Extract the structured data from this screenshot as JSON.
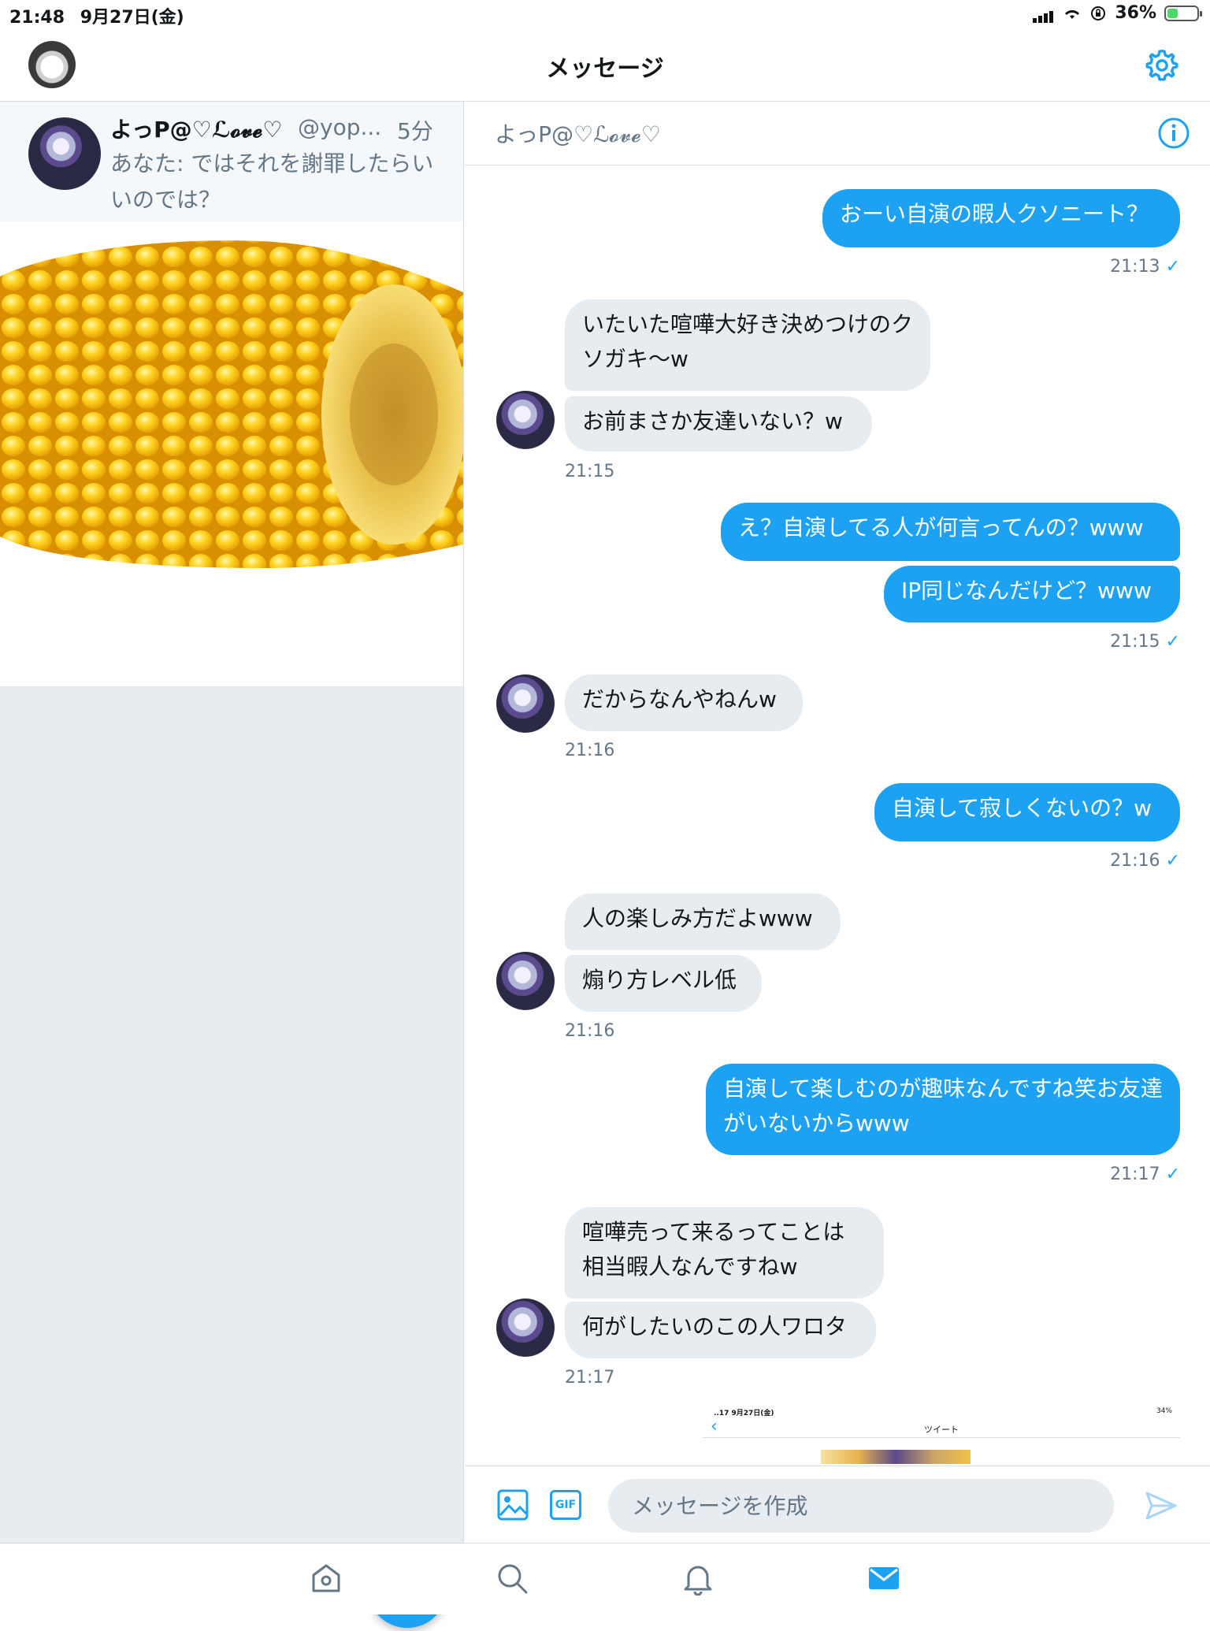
{
  "status": {
    "time": "21:48",
    "date": "9月27日(金)",
    "battery": "36%",
    "battery_level": 0.36
  },
  "nav": {
    "title": "メッセージ"
  },
  "conversation": {
    "name": "よっP@♡ℒ𝓸𝓿𝓮♡",
    "handle": "@yop...",
    "time": "5分",
    "preview": "あなた: ではそれを謝罪したらいいのでは？"
  },
  "chat": {
    "title": "よっP@♡ℒ𝓸𝓿𝓮♡",
    "messages": [
      {
        "id": "m1",
        "dir": "out",
        "text": "おーい自演の暇人クソニート？"
      },
      {
        "id": "m2",
        "dir": "in",
        "text": "いたいた喧嘩大好き決めつけのクソガキ〜w"
      },
      {
        "id": "m3",
        "dir": "in",
        "text": "お前まさか友達いない？w"
      },
      {
        "id": "m4",
        "dir": "out",
        "text": "え？自演してる人が何言ってんの？www"
      },
      {
        "id": "m5",
        "dir": "out",
        "text": "IP同じなんだけど？www"
      },
      {
        "id": "m6",
        "dir": "in",
        "text": "だからなんやねんw"
      },
      {
        "id": "m7",
        "dir": "out",
        "text": "自演して寂しくないの？w"
      },
      {
        "id": "m8",
        "dir": "in",
        "text": "人の楽しみ方だよwww"
      },
      {
        "id": "m9",
        "dir": "in",
        "text": "煽り方レベル低"
      },
      {
        "id": "m10",
        "dir": "out",
        "text": "自演して楽しむのが趣味なんですね笑お友達がいないからwww"
      },
      {
        "id": "m11",
        "dir": "in",
        "text": "喧嘩売って来るってことは相当暇人なんですねw"
      },
      {
        "id": "m12",
        "dir": "in",
        "text": "何がしたいのこの人ワロタ"
      }
    ],
    "timestamps": [
      {
        "id": "t1",
        "text": "21:13",
        "check": "✓"
      },
      {
        "id": "t2",
        "text": "21:15",
        "check": ""
      },
      {
        "id": "t3",
        "text": "21:15",
        "check": "✓"
      },
      {
        "id": "t4",
        "text": "21:16",
        "check": ""
      },
      {
        "id": "t5",
        "text": "21:16",
        "check": "✓"
      },
      {
        "id": "t6",
        "text": "21:16",
        "check": ""
      },
      {
        "id": "t7",
        "text": "21:17",
        "check": "✓"
      },
      {
        "id": "t8",
        "text": "21:17",
        "check": ""
      }
    ],
    "embed": {
      "status_time": "..17",
      "status_date": "9月27日(金)",
      "status_battery": "34%",
      "back": "‹",
      "title": "ツイート"
    }
  },
  "compose": {
    "placeholder": "メッセージを作成",
    "gif_label": "GIF"
  },
  "tabs": [
    {
      "id": "home",
      "icon": "home-icon",
      "active": false
    },
    {
      "id": "search",
      "icon": "search-icon",
      "active": false
    },
    {
      "id": "notifications",
      "icon": "bell-icon",
      "active": false
    },
    {
      "id": "messages",
      "icon": "envelope-icon",
      "active": true
    }
  ],
  "colors": {
    "accent": "#1da1f2",
    "panel_bg": "#e6ecf0",
    "muted": "#657786",
    "text": "#14171a"
  }
}
